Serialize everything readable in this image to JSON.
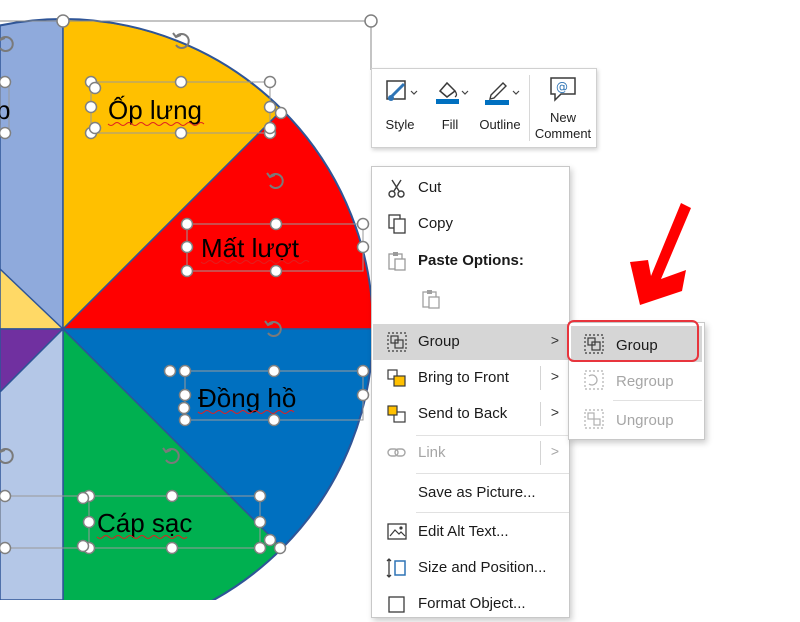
{
  "slices": [
    {
      "label": "Ốp lưng",
      "color": "#ffc000"
    },
    {
      "label": "Mất lượt",
      "color": "#ff0000"
    },
    {
      "label": "Đồng hồ",
      "color": "#0070c0"
    },
    {
      "label": "Cáp sạc",
      "color": "#00b050"
    },
    {
      "label": "p",
      "color": "#8faadc"
    }
  ],
  "other_slice_colors": [
    "#ffd966",
    "#7030a0",
    "#b4c7e7"
  ],
  "selection_color": "#808080",
  "accent_red": "#ff0000",
  "mini_toolbar": {
    "style_label": "Style",
    "fill_label": "Fill",
    "outline_label": "Outline",
    "new_comment_label_line1": "New",
    "new_comment_label_line2": "Comment"
  },
  "context_menu": {
    "cut": "Cut",
    "copy": "Copy",
    "paste_options": "Paste Options:",
    "group": "Group",
    "bring_to_front": "Bring to Front",
    "send_to_back": "Send to Back",
    "link": "Link",
    "save_as_picture": "Save as Picture...",
    "edit_alt_text": "Edit Alt Text...",
    "size_and_position": "Size and Position...",
    "format_object": "Format Object..."
  },
  "group_submenu": {
    "group": "Group",
    "regroup": "Regroup",
    "ungroup": "Ungroup"
  }
}
